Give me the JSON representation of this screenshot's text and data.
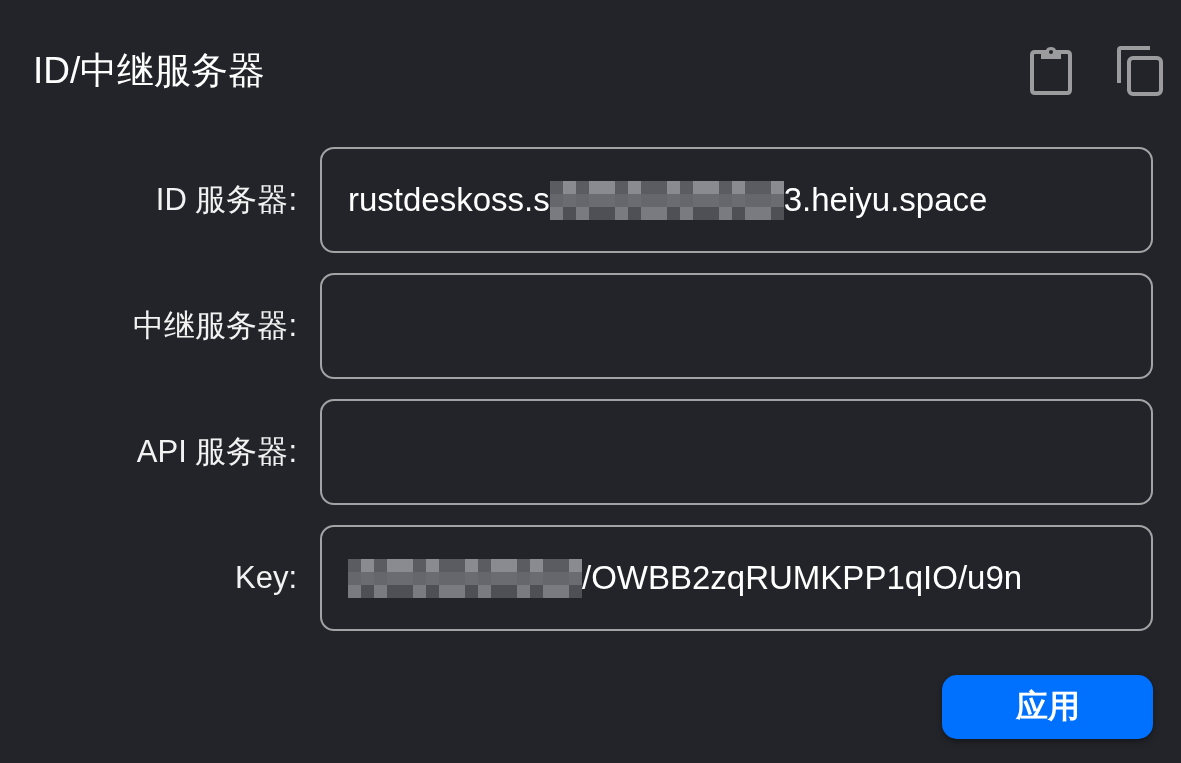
{
  "dialog": {
    "title": "ID/中继服务器"
  },
  "fields": [
    {
      "label": "ID 服务器:",
      "value": [
        {
          "kind": "text",
          "text": "rustdeskoss.s"
        },
        {
          "kind": "redacted"
        },
        {
          "kind": "text",
          "text": "3.heiyu.space"
        }
      ]
    },
    {
      "label": "中继服务器:"
    },
    {
      "label": "API 服务器:"
    },
    {
      "label": "Key:",
      "value": [
        {
          "kind": "redacted"
        },
        {
          "kind": "text",
          "text": "/OWBB2zqRUMKPP1qIO/u9n"
        }
      ]
    }
  ],
  "apply_button": {
    "label": "应用"
  }
}
